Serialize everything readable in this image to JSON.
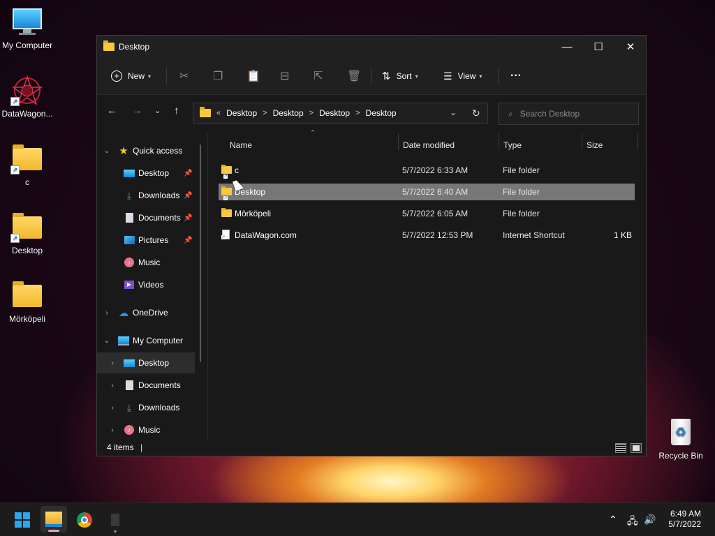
{
  "desktop": {
    "icons": [
      {
        "label": "My Computer"
      },
      {
        "label": "DataWagon..."
      },
      {
        "label": "c"
      },
      {
        "label": "Desktop"
      },
      {
        "label": "Mörköpeli"
      },
      {
        "label": "Recycle Bin"
      }
    ]
  },
  "window": {
    "title": "Desktop",
    "controls": {
      "minimize": "—",
      "maximize": "☐",
      "close": "✕"
    }
  },
  "toolbar": {
    "new_label": "New",
    "sort_label": "Sort",
    "view_label": "View",
    "more_label": "···"
  },
  "address": {
    "overflow": "«",
    "crumbs": [
      "Desktop",
      "Desktop",
      "Desktop",
      "Desktop"
    ],
    "separator": ">",
    "search_placeholder": "Search Desktop"
  },
  "sidebar": {
    "items": [
      {
        "label": "Quick access",
        "icon": "star-icon"
      },
      {
        "label": "Desktop",
        "icon": "desktop-icon",
        "pinned": true
      },
      {
        "label": "Downloads",
        "icon": "download-icon",
        "pinned": true
      },
      {
        "label": "Documents",
        "icon": "documents-icon",
        "pinned": true
      },
      {
        "label": "Pictures",
        "icon": "pictures-icon",
        "pinned": true
      },
      {
        "label": "Music",
        "icon": "music-icon"
      },
      {
        "label": "Videos",
        "icon": "videos-icon"
      },
      {
        "label": "OneDrive",
        "icon": "cloud-icon"
      },
      {
        "label": "My Computer",
        "icon": "computer-icon"
      },
      {
        "label": "Desktop",
        "icon": "desktop-icon",
        "selected": true
      },
      {
        "label": "Documents",
        "icon": "documents-icon"
      },
      {
        "label": "Downloads",
        "icon": "download-icon"
      },
      {
        "label": "Music",
        "icon": "music-icon"
      }
    ]
  },
  "files": {
    "columns": {
      "name": "Name",
      "date": "Date modified",
      "type": "Type",
      "size": "Size"
    },
    "rows": [
      {
        "name": "c",
        "date": "5/7/2022 6:33 AM",
        "type": "File folder",
        "size": "",
        "icon": "folder-shortcut-icon"
      },
      {
        "name": "Desktop",
        "date": "5/7/2022 6:40 AM",
        "type": "File folder",
        "size": "",
        "icon": "folder-shortcut-icon",
        "selected": true
      },
      {
        "name": "Mörköpeli",
        "date": "5/7/2022 6:05 AM",
        "type": "File folder",
        "size": "",
        "icon": "folder-icon"
      },
      {
        "name": "DataWagon.com",
        "date": "5/7/2022 12:53 PM",
        "type": "Internet Shortcut",
        "size": "1 KB",
        "icon": "internet-shortcut-icon"
      }
    ]
  },
  "status": {
    "items": "4 items"
  },
  "taskbar": {
    "time": "6:49 AM",
    "date": "5/7/2022"
  },
  "colors": {
    "selection": "#777777",
    "window_bg": "#191919",
    "accent": "#0078d4"
  }
}
